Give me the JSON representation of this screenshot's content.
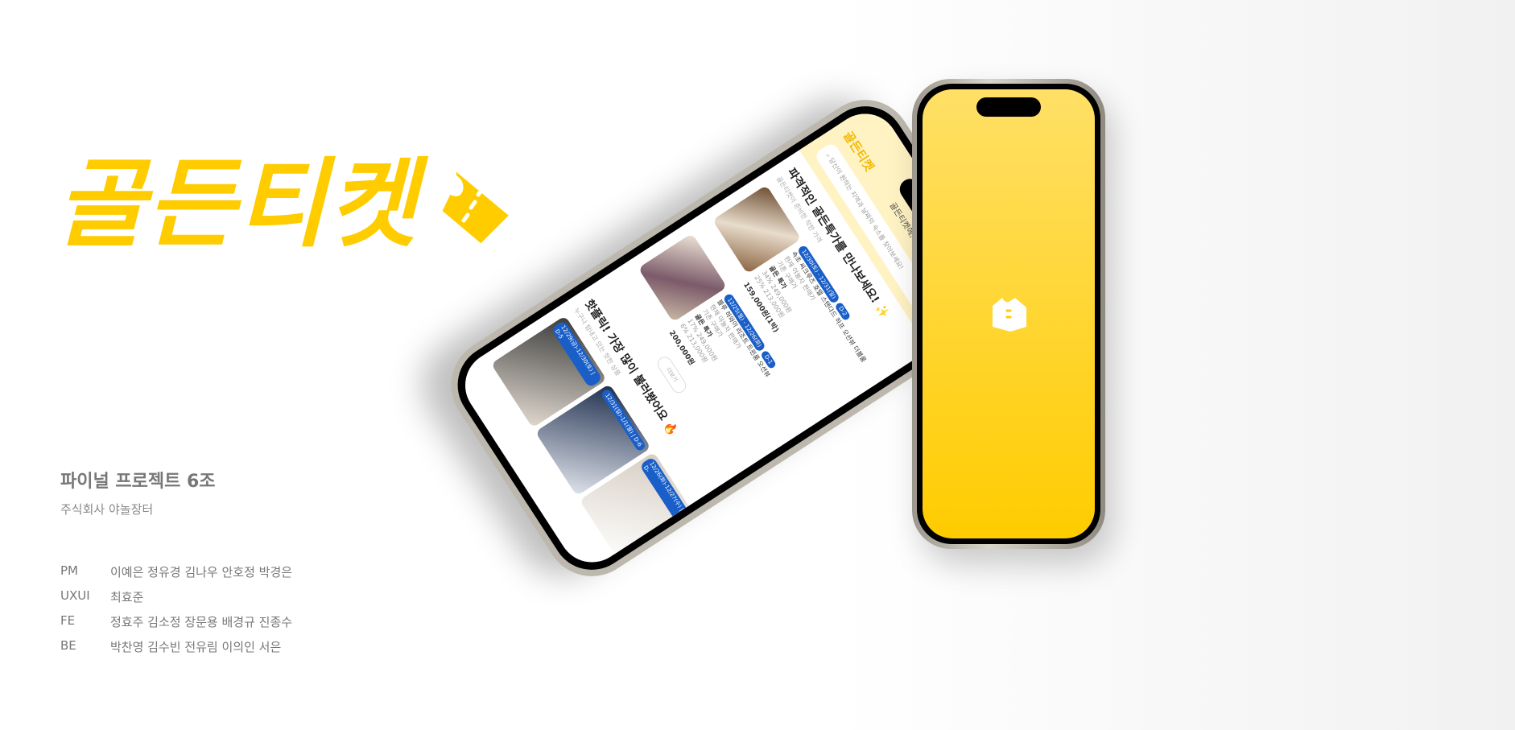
{
  "brand": {
    "name": "골든티켓",
    "color": "#FFCC00"
  },
  "project": {
    "title": "파이널 프로젝트 6조",
    "company": "주식회사 야놀장터"
  },
  "team": [
    {
      "role": "PM",
      "members": "이예은 정유경 김나우 안호정 박경은"
    },
    {
      "role": "UXUI",
      "members": "최효준"
    },
    {
      "role": "FE",
      "members": "정효주 김소정 장문용 배경규 진종수"
    },
    {
      "role": "BE",
      "members": "박찬영 김수빈 전유림 이의인 서은"
    }
  ],
  "app": {
    "logo": "골든티켓",
    "greeting": "골든티켓에, 환영합니다!",
    "search_placeholder": "당신이 원하는 지역과 날짜의 숙소를 찾아보세요!",
    "deals": {
      "title": "파격적인 골든특가를 만나보세요! ✨",
      "subtitle": "골든티켓이 준비한 착한 가격",
      "items": [
        {
          "dates": "12/30(토) - 12/31(일)",
          "dday": "D-2",
          "name": "속초 씨크루즈 호텔 스탠다드 하프 오션뷰 더블룸",
          "label": "골든 특가",
          "desc1": "현재 야놀자 판매가",
          "desc2": "기존 구매가",
          "pct1": "34% 249,000원",
          "pct2": "25% 213,000원",
          "price": "159,000원(1박)"
        },
        {
          "dates": "12/25(월) - 12/26(화)",
          "dday": "D-1",
          "name": "블루 하와이 리조트 트윈룸 오션뷰",
          "label": "골든 특가",
          "desc1": "현재 야놀자 판매가",
          "desc2": "기존 구매가",
          "pct1": "17% 249,000원",
          "pct2": "6% 213,000원",
          "price": "200,000원"
        }
      ],
      "more": "더보기"
    },
    "hot": {
      "title": "핫플릭! 가장 많이 불러봤어요 🔥",
      "subtitle": "누구나 탐내고 있는 핫한 상품",
      "items": [
        {
          "badge": "12/29(금)-12/30(토) | D-5"
        },
        {
          "badge": "12/31(일)-1/1(월) | D-6"
        },
        {
          "badge": "12/26(화)-12/27(수) | D-"
        }
      ]
    }
  }
}
